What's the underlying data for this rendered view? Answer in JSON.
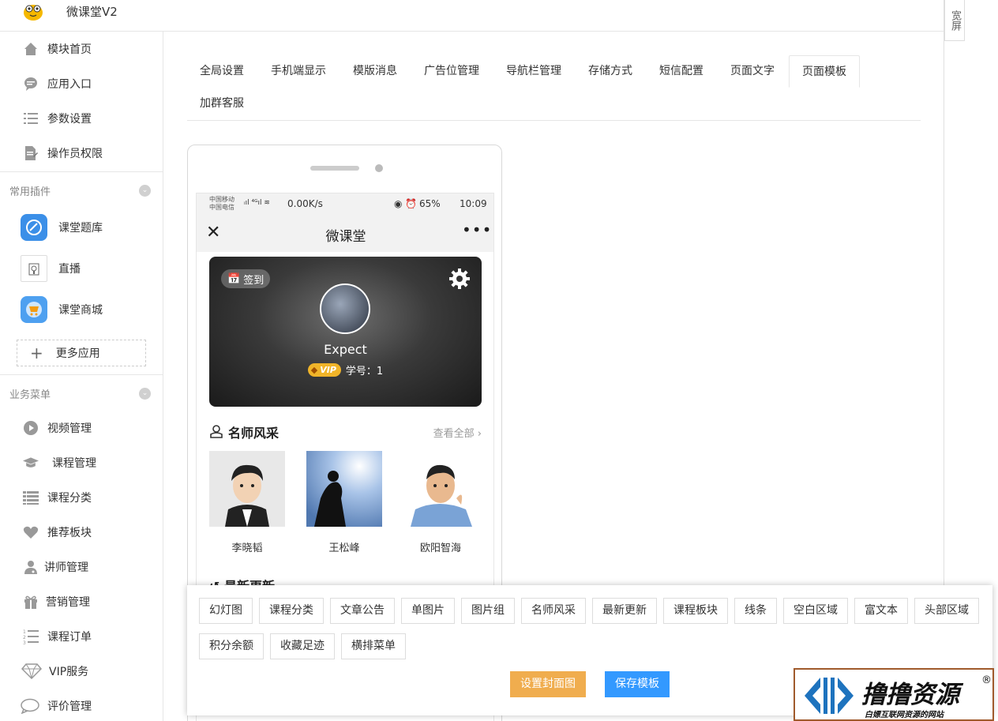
{
  "app": {
    "title": "微课堂V2",
    "wide_label": "宽屏"
  },
  "sidebar": {
    "main_items": [
      {
        "label": "模块首页",
        "icon": "home-icon"
      },
      {
        "label": "应用入口",
        "icon": "chat-bubble-icon"
      },
      {
        "label": "参数设置",
        "icon": "list-icon"
      },
      {
        "label": "操作员权限",
        "icon": "document-edit-icon"
      }
    ],
    "plugins_title": "常用插件",
    "plugins": [
      {
        "label": "课堂题库",
        "icon": "quiz-icon"
      },
      {
        "label": "直播",
        "icon": "live-icon"
      },
      {
        "label": "课堂商城",
        "icon": "cart-icon"
      }
    ],
    "more_apps": "更多应用",
    "business_title": "业务菜单",
    "business": [
      {
        "label": "视频管理",
        "icon": "play-icon"
      },
      {
        "label": "课程管理",
        "icon": "graduation-cap-icon"
      },
      {
        "label": "课程分类",
        "icon": "list-icon"
      },
      {
        "label": "推荐板块",
        "icon": "heart-icon"
      },
      {
        "label": "讲师管理",
        "icon": "user-doctor-icon"
      },
      {
        "label": "营销管理",
        "icon": "gift-icon"
      },
      {
        "label": "课程订单",
        "icon": "ordered-list-icon"
      },
      {
        "label": "VIP服务",
        "icon": "diamond-icon"
      },
      {
        "label": "评价管理",
        "icon": "comment-icon"
      }
    ]
  },
  "tabs": [
    {
      "label": "全局设置"
    },
    {
      "label": "手机端显示"
    },
    {
      "label": "模版消息"
    },
    {
      "label": "广告位管理"
    },
    {
      "label": "导航栏管理"
    },
    {
      "label": "存储方式"
    },
    {
      "label": "短信配置"
    },
    {
      "label": "页面文字"
    },
    {
      "label": "页面模板",
      "active": true
    },
    {
      "label": "加群客服"
    }
  ],
  "phone": {
    "status": {
      "carrier1": "中国移动",
      "carrier2": "中国电信",
      "speed": "0.00K/s",
      "battery": "65%",
      "time": "10:09"
    },
    "nav_title": "微课堂",
    "checkin": "签到",
    "username": "Expect",
    "vip": "VIP",
    "student_no": "学号：1",
    "teachers_title": "名师风采",
    "view_all": "查看全部",
    "teachers": [
      "李晓韬",
      "王松峰",
      "欧阳智海"
    ],
    "latest_title": "最新更新"
  },
  "components": {
    "row1": [
      "幻灯图",
      "课程分类",
      "文章公告",
      "单图片",
      "图片组",
      "名师风采",
      "最新更新",
      "课程板块",
      "线条",
      "空白区域",
      "富文本",
      "头部区域"
    ],
    "row2": [
      "积分余额",
      "收藏足迹",
      "横排菜单"
    ],
    "set_cover": "设置封面图",
    "save_template": "保存模板"
  },
  "watermark": {
    "title": "撸撸资源",
    "subtitle": "白嫖互联网资源的网站",
    "reg": "®"
  },
  "colors": {
    "accent_blue": "#3399ff",
    "accent_orange": "#f0ad4e",
    "vip_gold": "#f0b429"
  }
}
